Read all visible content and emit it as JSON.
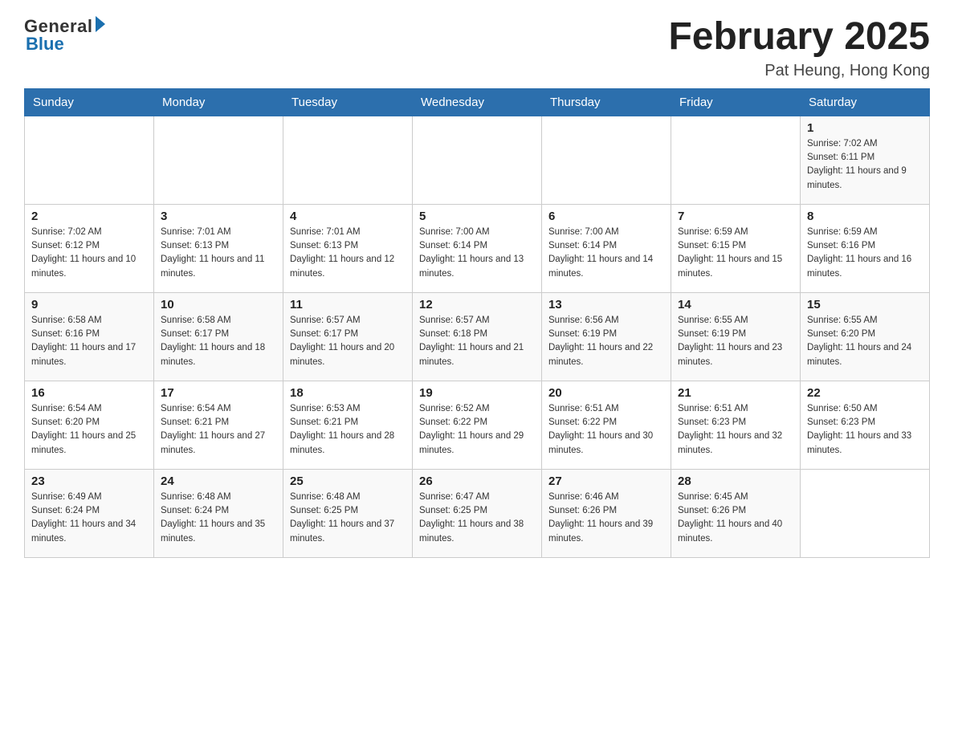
{
  "header": {
    "logo_general": "General",
    "logo_blue": "Blue",
    "month_title": "February 2025",
    "location": "Pat Heung, Hong Kong"
  },
  "weekdays": [
    "Sunday",
    "Monday",
    "Tuesday",
    "Wednesday",
    "Thursday",
    "Friday",
    "Saturday"
  ],
  "weeks": [
    [
      {
        "day": "",
        "sunrise": "",
        "sunset": "",
        "daylight": ""
      },
      {
        "day": "",
        "sunrise": "",
        "sunset": "",
        "daylight": ""
      },
      {
        "day": "",
        "sunrise": "",
        "sunset": "",
        "daylight": ""
      },
      {
        "day": "",
        "sunrise": "",
        "sunset": "",
        "daylight": ""
      },
      {
        "day": "",
        "sunrise": "",
        "sunset": "",
        "daylight": ""
      },
      {
        "day": "",
        "sunrise": "",
        "sunset": "",
        "daylight": ""
      },
      {
        "day": "1",
        "sunrise": "Sunrise: 7:02 AM",
        "sunset": "Sunset: 6:11 PM",
        "daylight": "Daylight: 11 hours and 9 minutes."
      }
    ],
    [
      {
        "day": "2",
        "sunrise": "Sunrise: 7:02 AM",
        "sunset": "Sunset: 6:12 PM",
        "daylight": "Daylight: 11 hours and 10 minutes."
      },
      {
        "day": "3",
        "sunrise": "Sunrise: 7:01 AM",
        "sunset": "Sunset: 6:13 PM",
        "daylight": "Daylight: 11 hours and 11 minutes."
      },
      {
        "day": "4",
        "sunrise": "Sunrise: 7:01 AM",
        "sunset": "Sunset: 6:13 PM",
        "daylight": "Daylight: 11 hours and 12 minutes."
      },
      {
        "day": "5",
        "sunrise": "Sunrise: 7:00 AM",
        "sunset": "Sunset: 6:14 PM",
        "daylight": "Daylight: 11 hours and 13 minutes."
      },
      {
        "day": "6",
        "sunrise": "Sunrise: 7:00 AM",
        "sunset": "Sunset: 6:14 PM",
        "daylight": "Daylight: 11 hours and 14 minutes."
      },
      {
        "day": "7",
        "sunrise": "Sunrise: 6:59 AM",
        "sunset": "Sunset: 6:15 PM",
        "daylight": "Daylight: 11 hours and 15 minutes."
      },
      {
        "day": "8",
        "sunrise": "Sunrise: 6:59 AM",
        "sunset": "Sunset: 6:16 PM",
        "daylight": "Daylight: 11 hours and 16 minutes."
      }
    ],
    [
      {
        "day": "9",
        "sunrise": "Sunrise: 6:58 AM",
        "sunset": "Sunset: 6:16 PM",
        "daylight": "Daylight: 11 hours and 17 minutes."
      },
      {
        "day": "10",
        "sunrise": "Sunrise: 6:58 AM",
        "sunset": "Sunset: 6:17 PM",
        "daylight": "Daylight: 11 hours and 18 minutes."
      },
      {
        "day": "11",
        "sunrise": "Sunrise: 6:57 AM",
        "sunset": "Sunset: 6:17 PM",
        "daylight": "Daylight: 11 hours and 20 minutes."
      },
      {
        "day": "12",
        "sunrise": "Sunrise: 6:57 AM",
        "sunset": "Sunset: 6:18 PM",
        "daylight": "Daylight: 11 hours and 21 minutes."
      },
      {
        "day": "13",
        "sunrise": "Sunrise: 6:56 AM",
        "sunset": "Sunset: 6:19 PM",
        "daylight": "Daylight: 11 hours and 22 minutes."
      },
      {
        "day": "14",
        "sunrise": "Sunrise: 6:55 AM",
        "sunset": "Sunset: 6:19 PM",
        "daylight": "Daylight: 11 hours and 23 minutes."
      },
      {
        "day": "15",
        "sunrise": "Sunrise: 6:55 AM",
        "sunset": "Sunset: 6:20 PM",
        "daylight": "Daylight: 11 hours and 24 minutes."
      }
    ],
    [
      {
        "day": "16",
        "sunrise": "Sunrise: 6:54 AM",
        "sunset": "Sunset: 6:20 PM",
        "daylight": "Daylight: 11 hours and 25 minutes."
      },
      {
        "day": "17",
        "sunrise": "Sunrise: 6:54 AM",
        "sunset": "Sunset: 6:21 PM",
        "daylight": "Daylight: 11 hours and 27 minutes."
      },
      {
        "day": "18",
        "sunrise": "Sunrise: 6:53 AM",
        "sunset": "Sunset: 6:21 PM",
        "daylight": "Daylight: 11 hours and 28 minutes."
      },
      {
        "day": "19",
        "sunrise": "Sunrise: 6:52 AM",
        "sunset": "Sunset: 6:22 PM",
        "daylight": "Daylight: 11 hours and 29 minutes."
      },
      {
        "day": "20",
        "sunrise": "Sunrise: 6:51 AM",
        "sunset": "Sunset: 6:22 PM",
        "daylight": "Daylight: 11 hours and 30 minutes."
      },
      {
        "day": "21",
        "sunrise": "Sunrise: 6:51 AM",
        "sunset": "Sunset: 6:23 PM",
        "daylight": "Daylight: 11 hours and 32 minutes."
      },
      {
        "day": "22",
        "sunrise": "Sunrise: 6:50 AM",
        "sunset": "Sunset: 6:23 PM",
        "daylight": "Daylight: 11 hours and 33 minutes."
      }
    ],
    [
      {
        "day": "23",
        "sunrise": "Sunrise: 6:49 AM",
        "sunset": "Sunset: 6:24 PM",
        "daylight": "Daylight: 11 hours and 34 minutes."
      },
      {
        "day": "24",
        "sunrise": "Sunrise: 6:48 AM",
        "sunset": "Sunset: 6:24 PM",
        "daylight": "Daylight: 11 hours and 35 minutes."
      },
      {
        "day": "25",
        "sunrise": "Sunrise: 6:48 AM",
        "sunset": "Sunset: 6:25 PM",
        "daylight": "Daylight: 11 hours and 37 minutes."
      },
      {
        "day": "26",
        "sunrise": "Sunrise: 6:47 AM",
        "sunset": "Sunset: 6:25 PM",
        "daylight": "Daylight: 11 hours and 38 minutes."
      },
      {
        "day": "27",
        "sunrise": "Sunrise: 6:46 AM",
        "sunset": "Sunset: 6:26 PM",
        "daylight": "Daylight: 11 hours and 39 minutes."
      },
      {
        "day": "28",
        "sunrise": "Sunrise: 6:45 AM",
        "sunset": "Sunset: 6:26 PM",
        "daylight": "Daylight: 11 hours and 40 minutes."
      },
      {
        "day": "",
        "sunrise": "",
        "sunset": "",
        "daylight": ""
      }
    ]
  ]
}
